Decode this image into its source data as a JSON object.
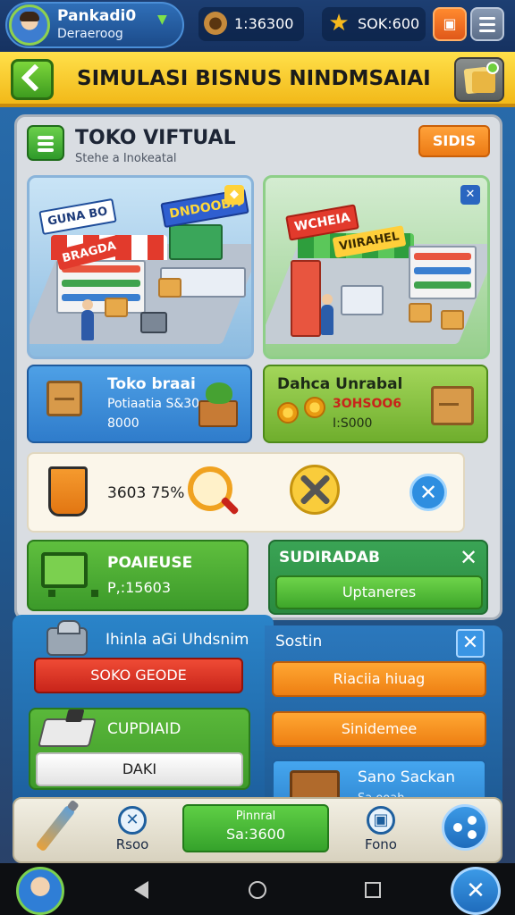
{
  "profile": {
    "name": "Pankadi0",
    "subtitle": "Deraeroog"
  },
  "resources": {
    "coins": "1:36300",
    "stars": "SOK:600"
  },
  "header": {
    "title": "SIMULASI BISNUS NINDMSAIAI"
  },
  "store": {
    "title": "TOKO VIFTUAL",
    "subtitle": "Stehe a Inokeatal",
    "status_label": "SIDIS"
  },
  "scenes": {
    "left": {
      "sign_a": "GUNA BO",
      "sign_b": "DNDOOBA",
      "sign_c": "BRAGDA"
    },
    "right": {
      "sign_a": "WCHEIA",
      "sign_b": "VIIRAHEL"
    }
  },
  "info_left": {
    "title": "Toko braai",
    "line1": "Potiaatia S&30",
    "line2": "8000"
  },
  "info_right": {
    "title": "Dahca Unrabal",
    "line1": "3OHSOO6",
    "line2": "I:S000"
  },
  "stats": {
    "text": "3603 75%"
  },
  "pocket": {
    "title": "POAIEUSE",
    "value": "P,:15603"
  },
  "upgrade": {
    "title": "SUDIRADAB",
    "button": "Uptaneres"
  },
  "section_left": {
    "title": "Ihinla aGi Uhdsnim",
    "red_button": "SOKO GEODE"
  },
  "print_card": {
    "title": "CUPDIAID",
    "button": "DAKI"
  },
  "section_right": {
    "title": "Sostin",
    "button1": "Riaciia hiuag",
    "button2": "Sinidemee"
  },
  "sale_card": {
    "title": "Sano Sackan",
    "subtitle": "Sa ooah"
  },
  "toolbar": {
    "item1_label": "Rsoo",
    "green_line1": "Pinnral",
    "green_line2": "Sa:3600",
    "item2_label": "Fono"
  },
  "colors": {
    "banner": "#f2b919",
    "accent_green": "#3e9a29",
    "accent_orange": "#ee7f12",
    "accent_red": "#c8241a"
  },
  "icons": [
    "avatar",
    "coin-icon",
    "star-icon",
    "menu-icon",
    "back-icon",
    "documents-icon",
    "store-icon",
    "cart-icon",
    "machine-icon",
    "printer-icon",
    "brush-icon",
    "tools-icon",
    "share-icon"
  ]
}
